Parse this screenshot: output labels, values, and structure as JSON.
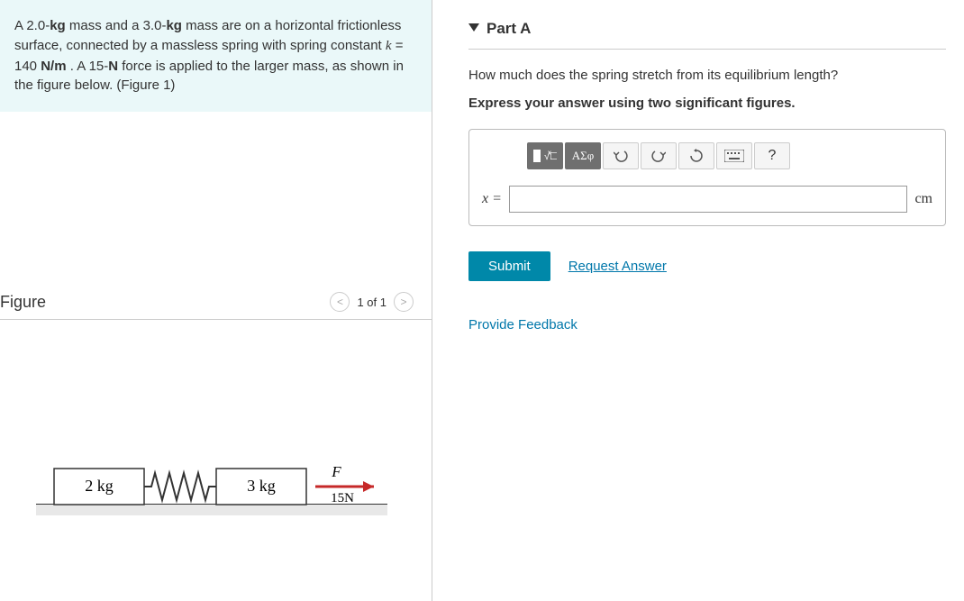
{
  "problem": {
    "html": "A 2.0-<span class='bold'>kg</span> mass and a 3.0-<span class='bold'>kg</span> mass are on a horizontal frictionless surface, connected by a massless spring with spring constant <i>k</i> = 140 <span class='bold'>N/m</span> . A 15-<span class='bold'>N</span> force is applied to the larger mass, as shown in the figure below. (Figure 1)"
  },
  "figure": {
    "title": "Figure",
    "nav_label": "1 of 1",
    "mass1": "2 kg",
    "mass2": "3 kg",
    "force_sym": "F⃗",
    "force_val": "15N"
  },
  "part": {
    "title": "Part A",
    "question": "How much does the spring stretch from its equilibrium length?",
    "instruction": "Express your answer using two significant figures.",
    "var": "x =",
    "unit": "cm",
    "greek": "ΑΣφ",
    "help": "?",
    "submit": "Submit",
    "request": "Request Answer"
  },
  "feedback": "Provide Feedback"
}
